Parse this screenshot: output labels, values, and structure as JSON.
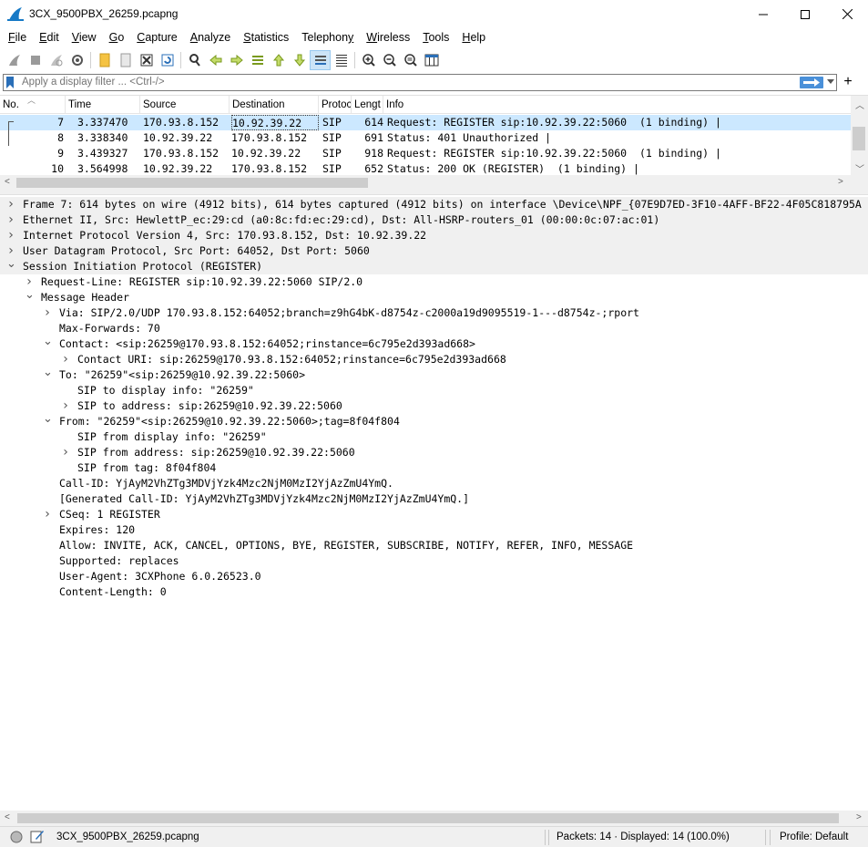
{
  "window": {
    "title": "3CX_9500PBX_26259.pcapng",
    "minimize_glyph": "—",
    "maximize_glyph": "☐",
    "close_glyph": "✕"
  },
  "menu": [
    {
      "label": "File",
      "key": "F",
      "rest": "ile"
    },
    {
      "label": "Edit",
      "key": "E",
      "rest": "dit"
    },
    {
      "label": "View",
      "key": "V",
      "rest": "iew"
    },
    {
      "label": "Go",
      "key": "G",
      "rest": "o"
    },
    {
      "label": "Capture",
      "key": "C",
      "rest": "apture"
    },
    {
      "label": "Analyze",
      "key": "A",
      "rest": "nalyze"
    },
    {
      "label": "Statistics",
      "key": "S",
      "rest": "tatistics"
    },
    {
      "label": "Telephony",
      "key": "y",
      "pre": "Telephon",
      "rest": ""
    },
    {
      "label": "Wireless",
      "key": "W",
      "rest": "ireless"
    },
    {
      "label": "Tools",
      "key": "T",
      "rest": "ools"
    },
    {
      "label": "Help",
      "key": "H",
      "rest": "elp"
    }
  ],
  "filter": {
    "placeholder": "Apply a display filter ... <Ctrl-/>",
    "add_label": "+"
  },
  "packet_list": {
    "columns": [
      "No.",
      "Time",
      "Source",
      "Destination",
      "Protocol",
      "Length",
      "Info"
    ],
    "columns_visible": [
      "No.",
      "Time",
      "Source",
      "Destination",
      "Protoc",
      "Lengt",
      "Info"
    ],
    "rows": [
      {
        "no": "7",
        "time": "3.337470",
        "src": "170.93.8.152",
        "dst": "10.92.39.22",
        "proto": "SIP",
        "len": "614",
        "info": "Request: REGISTER sip:10.92.39.22:5060  (1 binding) |",
        "selected": true
      },
      {
        "no": "8",
        "time": "3.338340",
        "src": "10.92.39.22",
        "dst": "170.93.8.152",
        "proto": "SIP",
        "len": "691",
        "info": "Status: 401 Unauthorized |"
      },
      {
        "no": "9",
        "time": "3.439327",
        "src": "170.93.8.152",
        "dst": "10.92.39.22",
        "proto": "SIP",
        "len": "918",
        "info": "Request: REGISTER sip:10.92.39.22:5060  (1 binding) |"
      },
      {
        "no": "10",
        "time": "3.564998",
        "src": "10.92.39.22",
        "dst": "170.93.8.152",
        "proto": "SIP",
        "len": "652",
        "info": "Status: 200 OK (REGISTER)  (1 binding) |"
      }
    ]
  },
  "details": [
    {
      "level": 0,
      "twisty": "closed",
      "top": true,
      "text": "Frame 7: 614 bytes on wire (4912 bits), 614 bytes captured (4912 bits) on interface \\Device\\NPF_{07E9D7ED-3F10-4AFF-BF22-4F05C818795A"
    },
    {
      "level": 0,
      "twisty": "closed",
      "top": true,
      "text": "Ethernet II, Src: HewlettP_ec:29:cd (a0:8c:fd:ec:29:cd), Dst: All-HSRP-routers_01 (00:00:0c:07:ac:01)"
    },
    {
      "level": 0,
      "twisty": "closed",
      "top": true,
      "text": "Internet Protocol Version 4, Src: 170.93.8.152, Dst: 10.92.39.22"
    },
    {
      "level": 0,
      "twisty": "closed",
      "top": true,
      "text": "User Datagram Protocol, Src Port: 64052, Dst Port: 5060"
    },
    {
      "level": 0,
      "twisty": "open",
      "top": true,
      "text": "Session Initiation Protocol (REGISTER)"
    },
    {
      "level": 1,
      "twisty": "closed",
      "text": "Request-Line: REGISTER sip:10.92.39.22:5060 SIP/2.0"
    },
    {
      "level": 1,
      "twisty": "open",
      "text": "Message Header"
    },
    {
      "level": 2,
      "twisty": "closed",
      "text": "Via: SIP/2.0/UDP 170.93.8.152:64052;branch=z9hG4bK-d8754z-c2000a19d9095519-1---d8754z-;rport"
    },
    {
      "level": 2,
      "twisty": "none",
      "text": "Max-Forwards: 70"
    },
    {
      "level": 2,
      "twisty": "open",
      "text": "Contact: <sip:26259@170.93.8.152:64052;rinstance=6c795e2d393ad668>"
    },
    {
      "level": 3,
      "twisty": "closed",
      "text": "Contact URI: sip:26259@170.93.8.152:64052;rinstance=6c795e2d393ad668"
    },
    {
      "level": 2,
      "twisty": "open",
      "text": "To: \"26259\"<sip:26259@10.92.39.22:5060>"
    },
    {
      "level": 3,
      "twisty": "none",
      "text": "SIP to display info: \"26259\""
    },
    {
      "level": 3,
      "twisty": "closed",
      "text": "SIP to address: sip:26259@10.92.39.22:5060"
    },
    {
      "level": 2,
      "twisty": "open",
      "text": "From: \"26259\"<sip:26259@10.92.39.22:5060>;tag=8f04f804"
    },
    {
      "level": 3,
      "twisty": "none",
      "text": "SIP from display info: \"26259\""
    },
    {
      "level": 3,
      "twisty": "closed",
      "text": "SIP from address: sip:26259@10.92.39.22:5060"
    },
    {
      "level": 3,
      "twisty": "none",
      "text": "SIP from tag: 8f04f804"
    },
    {
      "level": 2,
      "twisty": "none",
      "text": "Call-ID: YjAyM2VhZTg3MDVjYzk4Mzc2NjM0MzI2YjAzZmU4YmQ."
    },
    {
      "level": 2,
      "twisty": "none",
      "text": "[Generated Call-ID: YjAyM2VhZTg3MDVjYzk4Mzc2NjM0MzI2YjAzZmU4YmQ.]"
    },
    {
      "level": 2,
      "twisty": "closed",
      "text": "CSeq: 1 REGISTER"
    },
    {
      "level": 2,
      "twisty": "none",
      "text": "Expires: 120"
    },
    {
      "level": 2,
      "twisty": "none",
      "text": "Allow: INVITE, ACK, CANCEL, OPTIONS, BYE, REGISTER, SUBSCRIBE, NOTIFY, REFER, INFO, MESSAGE"
    },
    {
      "level": 2,
      "twisty": "none",
      "text": "Supported: replaces"
    },
    {
      "level": 2,
      "twisty": "none",
      "text": "User-Agent: 3CXPhone 6.0.26523.0"
    },
    {
      "level": 2,
      "twisty": "none",
      "text": "Content-Length: 0"
    }
  ],
  "statusbar": {
    "file": "3CX_9500PBX_26259.pcapng",
    "packets": "Packets: 14 · Displayed: 14 (100.0%)",
    "profile": "Profile: Default"
  },
  "colors": {
    "selection": "#cce8ff",
    "accent": "#4a90d9"
  }
}
